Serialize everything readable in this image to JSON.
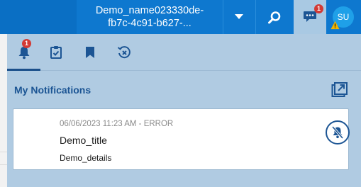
{
  "header": {
    "title_line1": "Demo_name023330de-",
    "title_line2": "fb7c-4c91-b627-...",
    "chat_badge": "1",
    "avatar_initials": "SU",
    "icons": [
      "chevron-down-icon",
      "search-icon",
      "chat-icon",
      "warning-icon"
    ]
  },
  "tabs": [
    {
      "name": "notifications",
      "icon": "bell-icon",
      "badge": "1",
      "active": true
    },
    {
      "name": "tasks",
      "icon": "clipboard-check-icon"
    },
    {
      "name": "bookmarks",
      "icon": "bookmark-icon"
    },
    {
      "name": "dismissed",
      "icon": "clock-x-icon"
    }
  ],
  "section": {
    "title": "My Notifications",
    "popout_icon": "popout-icon"
  },
  "notification": {
    "meta": "06/06/2023 11:23 AM - ERROR",
    "title": "Demo_title",
    "details": "Demo_details",
    "action_icon": "mute-bell-icon"
  },
  "colors": {
    "topbar": "#0e78cf",
    "panel": "#b0cbe2",
    "accent": "#1c5594",
    "badge": "#d23a35"
  }
}
